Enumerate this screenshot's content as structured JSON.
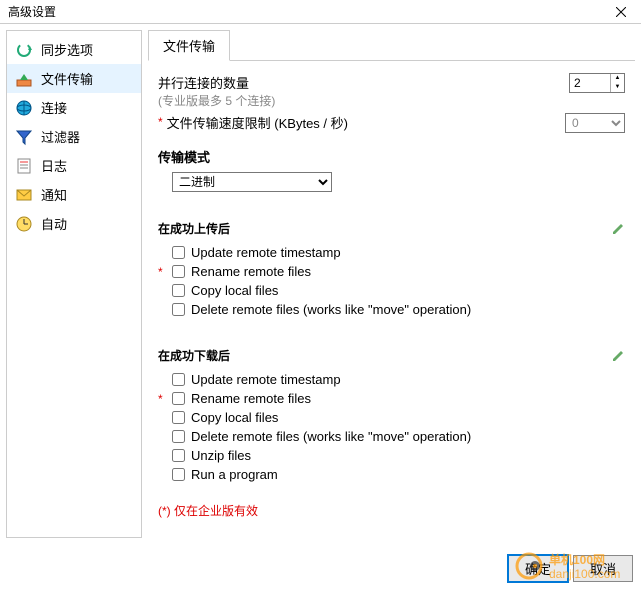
{
  "window_title": "高级设置",
  "sidebar": {
    "items": [
      {
        "label": "同步选项"
      },
      {
        "label": "文件传输"
      },
      {
        "label": "连接"
      },
      {
        "label": "过滤器"
      },
      {
        "label": "日志"
      },
      {
        "label": "通知"
      },
      {
        "label": "自动"
      }
    ]
  },
  "tab": {
    "label": "文件传输"
  },
  "parallel": {
    "label": "并行连接的数量",
    "hint": "(专业版最多 5 个连接)",
    "value": "2"
  },
  "speed": {
    "label": "文件传输速度限制 (KBytes / 秒)",
    "value": "0"
  },
  "mode": {
    "heading": "传输模式",
    "value": "二进制"
  },
  "upload": {
    "heading": "在成功上传后",
    "items": [
      {
        "label": "Update remote timestamp"
      },
      {
        "label": "Rename remote files"
      },
      {
        "label": "Copy local files"
      },
      {
        "label": "Delete remote files (works like \"move\" operation)"
      }
    ]
  },
  "download": {
    "heading": "在成功下载后",
    "items": [
      {
        "label": "Update remote timestamp"
      },
      {
        "label": "Rename remote files"
      },
      {
        "label": "Copy local files"
      },
      {
        "label": "Delete remote files (works like \"move\" operation)"
      },
      {
        "label": "Unzip files"
      },
      {
        "label": "Run a program"
      }
    ]
  },
  "enterprise_note": "(*) 仅在企业版有效",
  "buttons": {
    "ok": "确定",
    "cancel": "取消"
  },
  "watermark": {
    "line1": "单机100网",
    "line2": "danji100.com"
  }
}
